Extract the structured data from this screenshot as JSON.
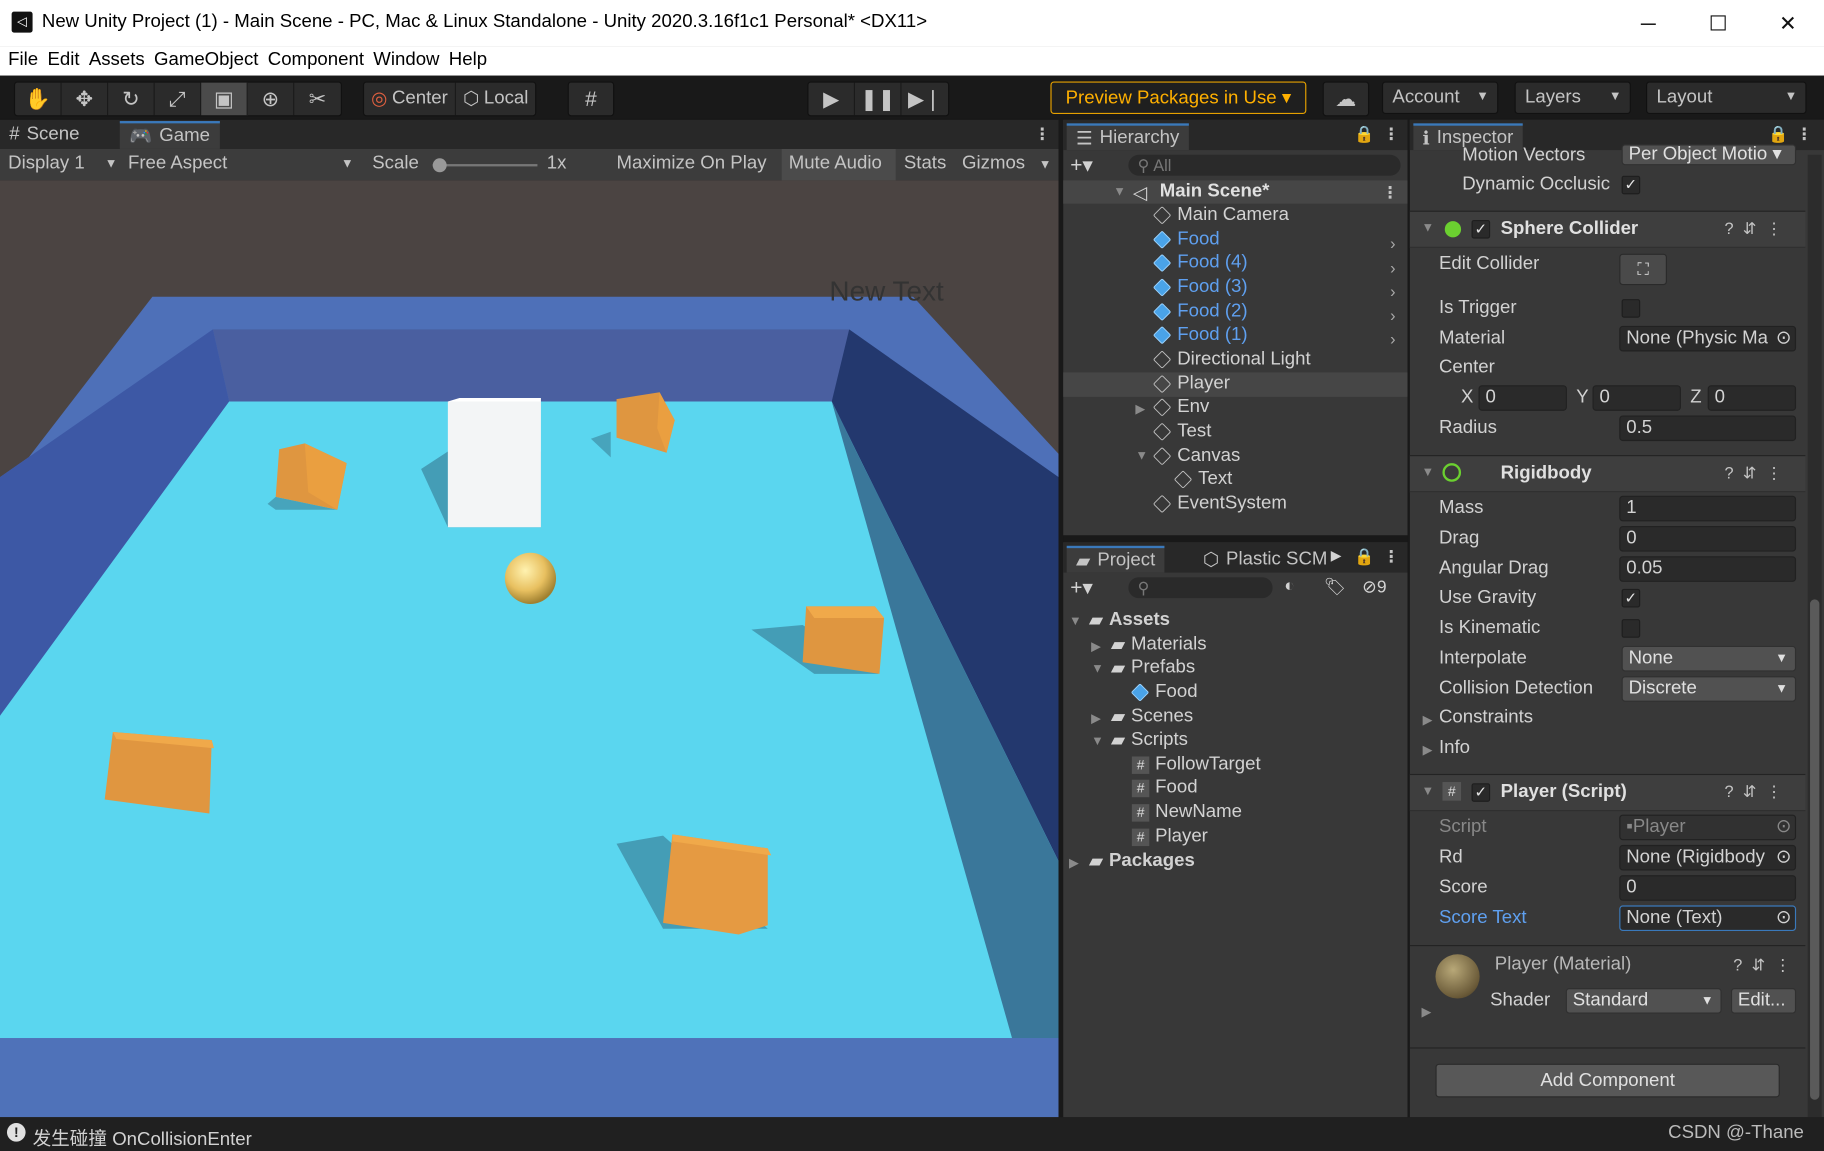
{
  "window": {
    "title": "New Unity Project (1) - Main Scene - PC, Mac & Linux Standalone - Unity 2020.3.16f1c1 Personal* <DX11>",
    "minimize": "─",
    "maximize": "☐",
    "close": "✕"
  },
  "menu": [
    "File",
    "Edit",
    "Assets",
    "GameObject",
    "Component",
    "Window",
    "Help"
  ],
  "toolbar": {
    "pivot_label": "Center",
    "space_label": "Local",
    "preview_packages": "Preview Packages in Use",
    "account": "Account",
    "layers": "Layers",
    "layout": "Layout"
  },
  "scene_tabs": {
    "scene": "Scene",
    "game": "Game"
  },
  "game_bar": {
    "display": "Display 1",
    "aspect": "Free Aspect",
    "scale_label": "Scale",
    "scale_value": "1x",
    "maximize_on_play": "Maximize On Play",
    "mute_audio": "Mute Audio",
    "stats": "Stats",
    "gizmos": "Gizmos"
  },
  "game_view": {
    "ui_text": "New Text"
  },
  "hierarchy": {
    "tab": "Hierarchy",
    "search_placeholder": "All",
    "scene": "Main Scene*",
    "items": [
      {
        "label": "Main Camera",
        "prefab": false
      },
      {
        "label": "Food",
        "prefab": true
      },
      {
        "label": "Food (4)",
        "prefab": true
      },
      {
        "label": "Food (3)",
        "prefab": true
      },
      {
        "label": "Food (2)",
        "prefab": true
      },
      {
        "label": "Food (1)",
        "prefab": true
      },
      {
        "label": "Directional Light",
        "prefab": false
      },
      {
        "label": "Player",
        "prefab": false
      },
      {
        "label": "Env",
        "prefab": false
      },
      {
        "label": "Test",
        "prefab": false
      },
      {
        "label": "Canvas",
        "prefab": false
      },
      {
        "label": "Text",
        "prefab": false
      },
      {
        "label": "EventSystem",
        "prefab": false
      }
    ]
  },
  "project": {
    "tab": "Project",
    "plastic_tab": "Plastic SCM",
    "hidden_count": "9",
    "tree": [
      {
        "label": "Assets",
        "type": "folder"
      },
      {
        "label": "Materials",
        "type": "folder"
      },
      {
        "label": "Prefabs",
        "type": "folder"
      },
      {
        "label": "Food",
        "type": "prefab"
      },
      {
        "label": "Scenes",
        "type": "folder"
      },
      {
        "label": "Scripts",
        "type": "folder"
      },
      {
        "label": "FollowTarget",
        "type": "script"
      },
      {
        "label": "Food",
        "type": "script"
      },
      {
        "label": "NewName",
        "type": "script"
      },
      {
        "label": "Player",
        "type": "script"
      },
      {
        "label": "Packages",
        "type": "folder"
      }
    ]
  },
  "inspector": {
    "tab": "Inspector",
    "motion_vectors_label": "Motion Vectors",
    "motion_vectors_value": "Per Object Motio",
    "dynamic_occlusion_label": "Dynamic Occlusic",
    "sphere_collider": {
      "title": "Sphere Collider",
      "edit_collider": "Edit Collider",
      "is_trigger": "Is Trigger",
      "material": "Material",
      "material_value": "None (Physic Ma",
      "center": "Center",
      "x": "0",
      "y": "0",
      "z": "0",
      "radius": "Radius",
      "radius_value": "0.5"
    },
    "rigidbody": {
      "title": "Rigidbody",
      "mass": "Mass",
      "mass_value": "1",
      "drag": "Drag",
      "drag_value": "0",
      "angular_drag": "Angular Drag",
      "angular_drag_value": "0.05",
      "use_gravity": "Use Gravity",
      "is_kinematic": "Is Kinematic",
      "interpolate": "Interpolate",
      "interpolate_value": "None",
      "collision_detection": "Collision Detection",
      "collision_detection_value": "Discrete",
      "constraints": "Constraints",
      "info": "Info"
    },
    "player_script": {
      "title": "Player (Script)",
      "script": "Script",
      "script_value": "Player",
      "rd": "Rd",
      "rd_value": "None (Rigidbody",
      "score": "Score",
      "score_value": "0",
      "score_text": "Score Text",
      "score_text_value": "None (Text)"
    },
    "material": {
      "title": "Player (Material)",
      "shader_label": "Shader",
      "shader_value": "Standard",
      "edit": "Edit..."
    },
    "add_component": "Add Component"
  },
  "status": {
    "message": "发生碰撞 OnCollisionEnter",
    "watermark": "CSDN @-Thane"
  },
  "colors": {
    "accent": "#3a79bb",
    "prefab_blue": "#5fa0f0",
    "play_accent": "#ffa500"
  }
}
